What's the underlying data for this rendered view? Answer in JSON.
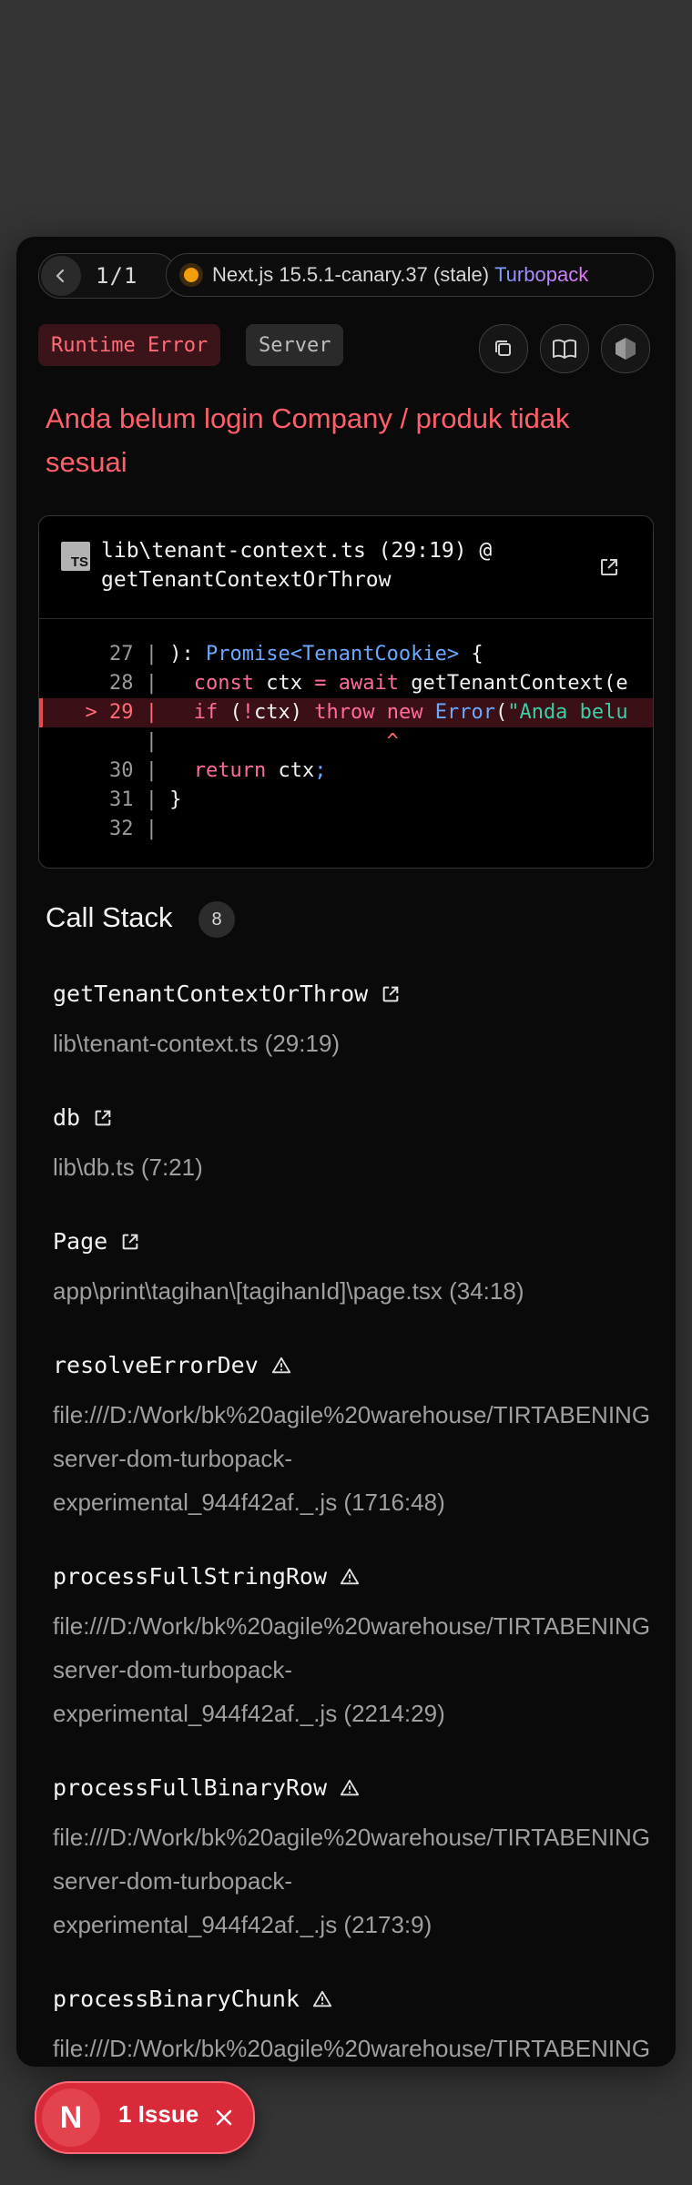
{
  "nav": {
    "pager": "1/1",
    "version": "Next.js 15.5.1-canary.37 (stale)",
    "bundler": "Turbopack",
    "status_color": "#f59e0b"
  },
  "badges": {
    "error_type": "Runtime Error",
    "environment": "Server"
  },
  "error": {
    "message": "Anda belum login Company / produk tidak sesuai"
  },
  "code_frame": {
    "language_icon": "TS",
    "file_line1": "lib\\tenant-context.ts (29:19) @",
    "file_line2": "getTenantContextOrThrow",
    "lines": [
      {
        "gutter": "27 |",
        "code": "): Promise<TenantCookie> {"
      },
      {
        "gutter": "28 |",
        "code": "  const ctx = await getTenantContext(e"
      },
      {
        "gutter": "> 29 |",
        "code": "  if (!ctx) throw new Error(\"Anda belu"
      },
      {
        "gutter": "|",
        "code": "                  ^"
      },
      {
        "gutter": "30 |",
        "code": "  return ctx;"
      },
      {
        "gutter": "31 |",
        "code": "}"
      },
      {
        "gutter": "32 |",
        "code": ""
      }
    ]
  },
  "call_stack": {
    "title": "Call Stack",
    "count": "8",
    "frames": [
      {
        "name": "getTenantContextOrThrow",
        "location": "lib\\tenant-context.ts (29:19)",
        "icon": "external-link-icon"
      },
      {
        "name": "db",
        "location": "lib\\db.ts (7:21)",
        "icon": "external-link-icon"
      },
      {
        "name": "Page",
        "location": "app\\print\\tagihan\\[tagihanId]\\page.tsx (34:18)",
        "icon": "external-link-icon"
      },
      {
        "name": "resolveErrorDev",
        "loc1": "file:///D:/Work/bk%20agile%20warehouse/TIRTABENING",
        "loc2": "server-dom-turbopack-",
        "loc3": "experimental_944f42af._.js (1716:48)",
        "icon": "warning-icon"
      },
      {
        "name": "processFullStringRow",
        "loc1": "file:///D:/Work/bk%20agile%20warehouse/TIRTABENING",
        "loc2": "server-dom-turbopack-",
        "loc3": "experimental_944f42af._.js (2214:29)",
        "icon": "warning-icon"
      },
      {
        "name": "processFullBinaryRow",
        "loc1": "file:///D:/Work/bk%20agile%20warehouse/TIRTABENING",
        "loc2": "server-dom-turbopack-",
        "loc3": "experimental_944f42af._.js (2173:9)",
        "icon": "warning-icon"
      },
      {
        "name": "processBinaryChunk",
        "loc1": "file:///D:/Work/bk%20agile%20warehouse/TIRTABENING",
        "icon": "warning-icon"
      }
    ]
  },
  "issues": {
    "logo": "N",
    "label": "1 Issue"
  }
}
